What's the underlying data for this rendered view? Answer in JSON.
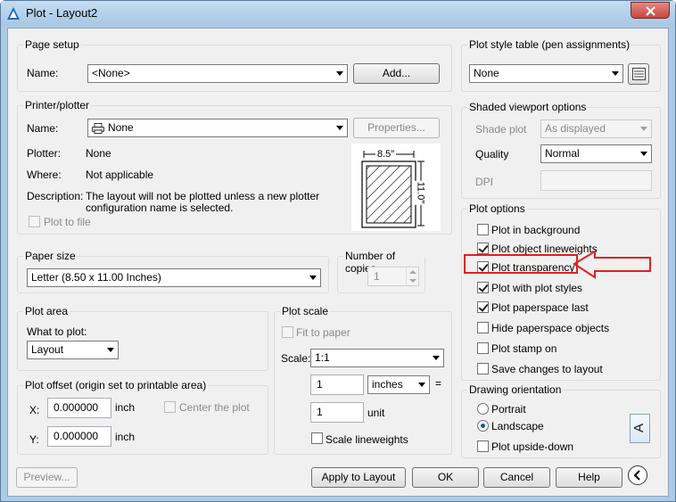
{
  "window": {
    "title": "Plot - Layout2",
    "close_icon": "close-icon"
  },
  "page_setup": {
    "title": "Page setup",
    "name_label": "Name:",
    "name_value": "<None>",
    "add_button": "Add..."
  },
  "printer": {
    "title": "Printer/plotter",
    "name_label": "Name:",
    "name_value": "None",
    "properties_button": "Properties...",
    "plotter_label": "Plotter:",
    "plotter_value": "None",
    "where_label": "Where:",
    "where_value": "Not applicable",
    "description_label": "Description:",
    "description_line1": "The layout will not be plotted unless a new plotter",
    "description_line2": "configuration name is selected.",
    "plot_to_file": "Plot to file",
    "preview_width": "8.5″",
    "preview_height": "11.0″"
  },
  "paper_size": {
    "title": "Paper size",
    "value": "Letter (8.50 x 11.00 Inches)"
  },
  "copies": {
    "title": "Number of copies",
    "value": "1"
  },
  "plot_area": {
    "title": "Plot area",
    "what_label": "What to plot:",
    "what_value": "Layout"
  },
  "plot_scale": {
    "title": "Plot scale",
    "fit_to_paper": "Fit to paper",
    "scale_label": "Scale:",
    "scale_value": "1:1",
    "value1": "1",
    "unit1": "inches",
    "equals": "=",
    "value2": "1",
    "unit2": "unit",
    "scale_lineweights": "Scale lineweights"
  },
  "plot_offset": {
    "title": "Plot offset (origin set to printable area)",
    "x_label": "X:",
    "x_value": "0.000000",
    "x_unit": "inch",
    "y_label": "Y:",
    "y_value": "0.000000",
    "y_unit": "inch",
    "center": "Center the plot"
  },
  "plot_style": {
    "title": "Plot style table (pen assignments)",
    "value": "None"
  },
  "shaded": {
    "title": "Shaded viewport options",
    "shade_label": "Shade plot",
    "shade_value": "As displayed",
    "quality_label": "Quality",
    "quality_value": "Normal",
    "dpi_label": "DPI"
  },
  "plot_options": {
    "title": "Plot options",
    "items": [
      {
        "label": "Plot in background",
        "checked": false
      },
      {
        "label": "Plot object lineweights",
        "checked": true
      },
      {
        "label": "Plot transparency",
        "checked": true
      },
      {
        "label": "Plot with plot styles",
        "checked": true
      },
      {
        "label": "Plot paperspace last",
        "checked": true
      },
      {
        "label": "Hide paperspace objects",
        "checked": false
      },
      {
        "label": "Plot stamp on",
        "checked": false
      },
      {
        "label": "Save changes to layout",
        "checked": false
      }
    ]
  },
  "orientation": {
    "title": "Drawing orientation",
    "portrait": "Portrait",
    "landscape": "Landscape",
    "upside_down": "Plot upside-down",
    "icon_letter": "A"
  },
  "footer": {
    "preview": "Preview...",
    "apply": "Apply to Layout",
    "ok": "OK",
    "cancel": "Cancel",
    "help": "Help"
  },
  "colors": {
    "annotation_arrow": "#e02020",
    "title_bar": "#b8d3ee",
    "close_button": "#c9463d"
  }
}
